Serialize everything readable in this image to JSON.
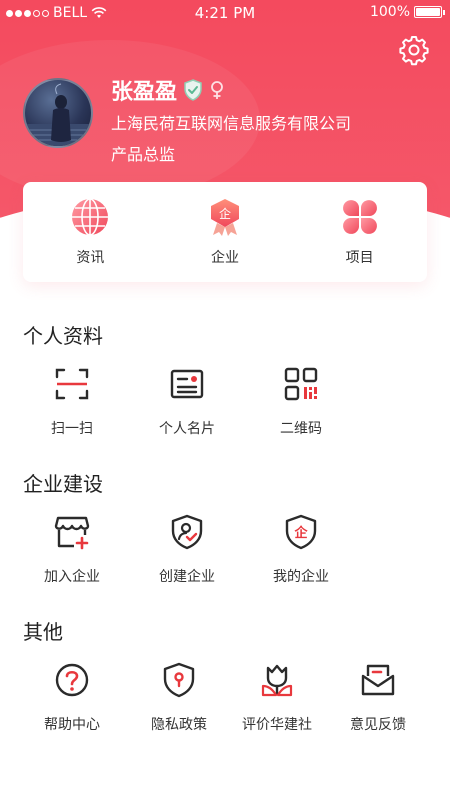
{
  "status_bar": {
    "carrier": "BELL",
    "time": "4:21 PM",
    "battery": "100%"
  },
  "colors": {
    "brand": "#f44a5e",
    "icon_dark": "#2b2b2b",
    "icon_accent": "#e8383d"
  },
  "profile": {
    "name": "张盈盈",
    "company": "上海民荷互联网信息服务有限公司",
    "title": "产品总监"
  },
  "quick_card": {
    "items": [
      {
        "label": "资讯",
        "icon": "globe-icon"
      },
      {
        "label": "企业",
        "icon": "enterprise-badge-icon"
      },
      {
        "label": "项目",
        "icon": "clover-icon"
      }
    ]
  },
  "sections": [
    {
      "title": "个人资料",
      "items": [
        {
          "label": "扫一扫",
          "icon": "scan-icon"
        },
        {
          "label": "个人名片",
          "icon": "business-card-icon"
        },
        {
          "label": "二维码",
          "icon": "qr-code-icon"
        }
      ]
    },
    {
      "title": "企业建设",
      "items": [
        {
          "label": "加入企业",
          "icon": "store-add-icon"
        },
        {
          "label": "创建企业",
          "icon": "shield-user-icon"
        },
        {
          "label": "我的企业",
          "icon": "shield-enterprise-icon"
        }
      ]
    },
    {
      "title": "其他",
      "items": [
        {
          "label": "帮助中心",
          "icon": "help-icon"
        },
        {
          "label": "隐私政策",
          "icon": "privacy-shield-icon"
        },
        {
          "label": "评价华建社",
          "icon": "tulip-icon"
        },
        {
          "label": "意见反馈",
          "icon": "feedback-envelope-icon"
        }
      ]
    }
  ]
}
